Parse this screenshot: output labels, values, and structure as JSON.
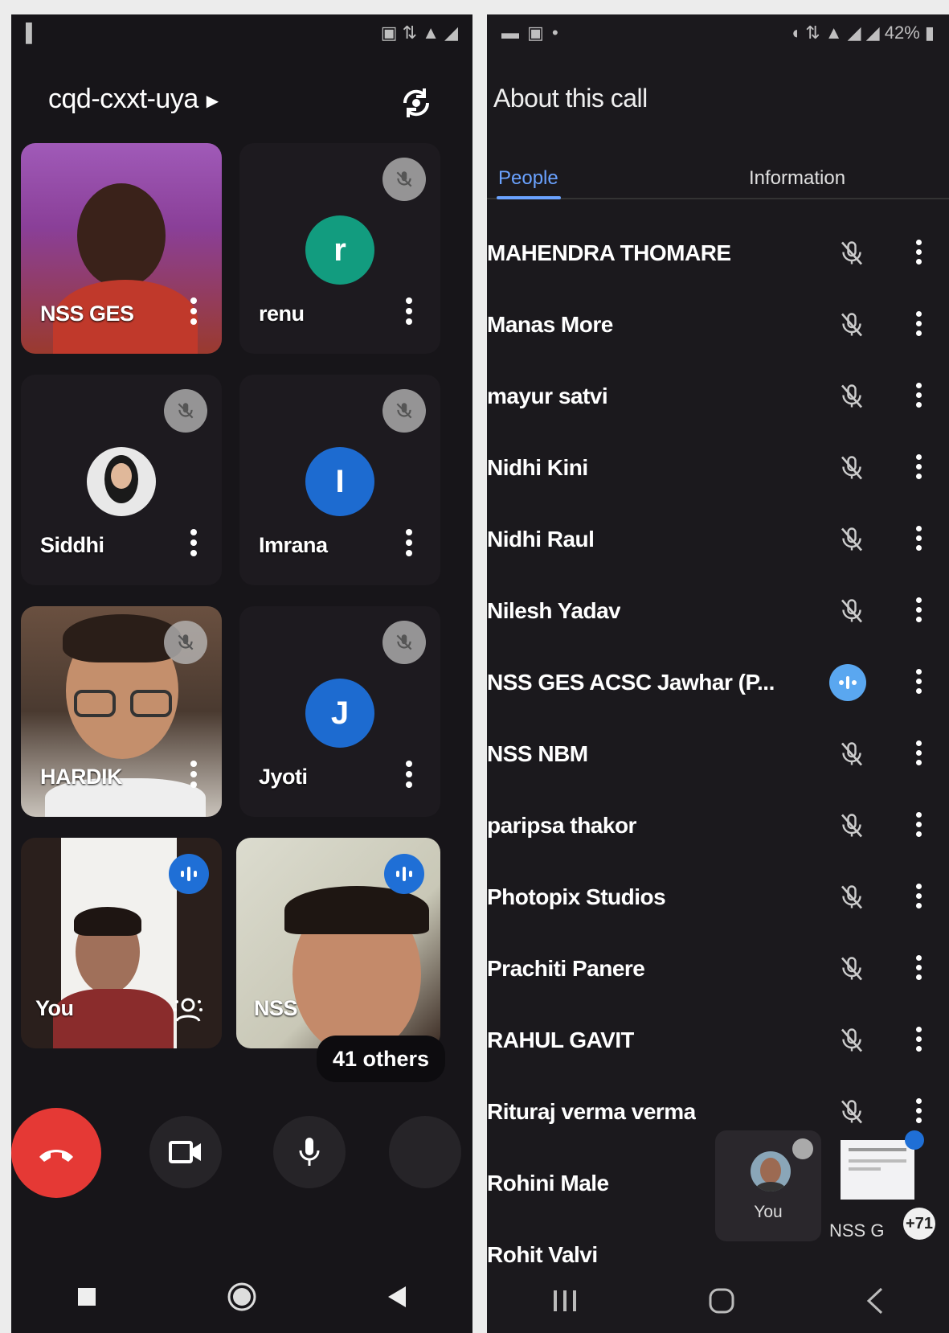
{
  "left": {
    "meeting_code": "cqd-cxxt-uya",
    "participants": [
      {
        "name": "NSS GES",
        "kind": "video",
        "muted": false
      },
      {
        "name": "renu",
        "kind": "letter",
        "letter": "r",
        "avatar_color": "#129c7f",
        "muted": true
      },
      {
        "name": "Siddhi",
        "kind": "photo",
        "muted": true
      },
      {
        "name": "Imrana",
        "kind": "letter",
        "letter": "I",
        "avatar_color": "#1d6bd0",
        "muted": true
      },
      {
        "name": "HARDIK",
        "kind": "video",
        "muted": true
      },
      {
        "name": "Jyoti",
        "kind": "letter",
        "letter": "J",
        "avatar_color": "#1d6bd0",
        "muted": true
      },
      {
        "name": "You",
        "kind": "video",
        "speaking": true
      },
      {
        "name": "NSS",
        "kind": "video",
        "speaking": true
      }
    ],
    "others_label": "41 others"
  },
  "right": {
    "title": "About this call",
    "tabs": {
      "people": "People",
      "information": "Information"
    },
    "people": [
      {
        "name": "MAHENDRA THOMARE",
        "status": "muted"
      },
      {
        "name": "Manas More",
        "status": "muted"
      },
      {
        "name": "mayur satvi",
        "status": "muted"
      },
      {
        "name": "Nidhi Kini",
        "status": "muted"
      },
      {
        "name": "Nidhi Raul",
        "status": "muted"
      },
      {
        "name": "Nilesh Yadav",
        "status": "muted"
      },
      {
        "name": "NSS GES ACSC Jawhar (P...",
        "status": "speaking"
      },
      {
        "name": "NSS NBM",
        "status": "muted"
      },
      {
        "name": "paripsa thakor",
        "status": "muted"
      },
      {
        "name": "Photopix Studios",
        "status": "muted"
      },
      {
        "name": "Prachiti Panere",
        "status": "muted"
      },
      {
        "name": "RAHUL GAVIT",
        "status": "muted"
      },
      {
        "name": "Rituraj verma verma",
        "status": "muted"
      },
      {
        "name": "Rohini Male",
        "status": "none"
      },
      {
        "name": "Rohit Valvi",
        "status": "none"
      }
    ],
    "pip_you_label": "You",
    "pip_nss_label": "NSS G",
    "pip_chip": "+71"
  },
  "colors": {
    "accent": "#6aa2ff",
    "hangup": "#e53935",
    "speaking": "#1f6fd6"
  }
}
